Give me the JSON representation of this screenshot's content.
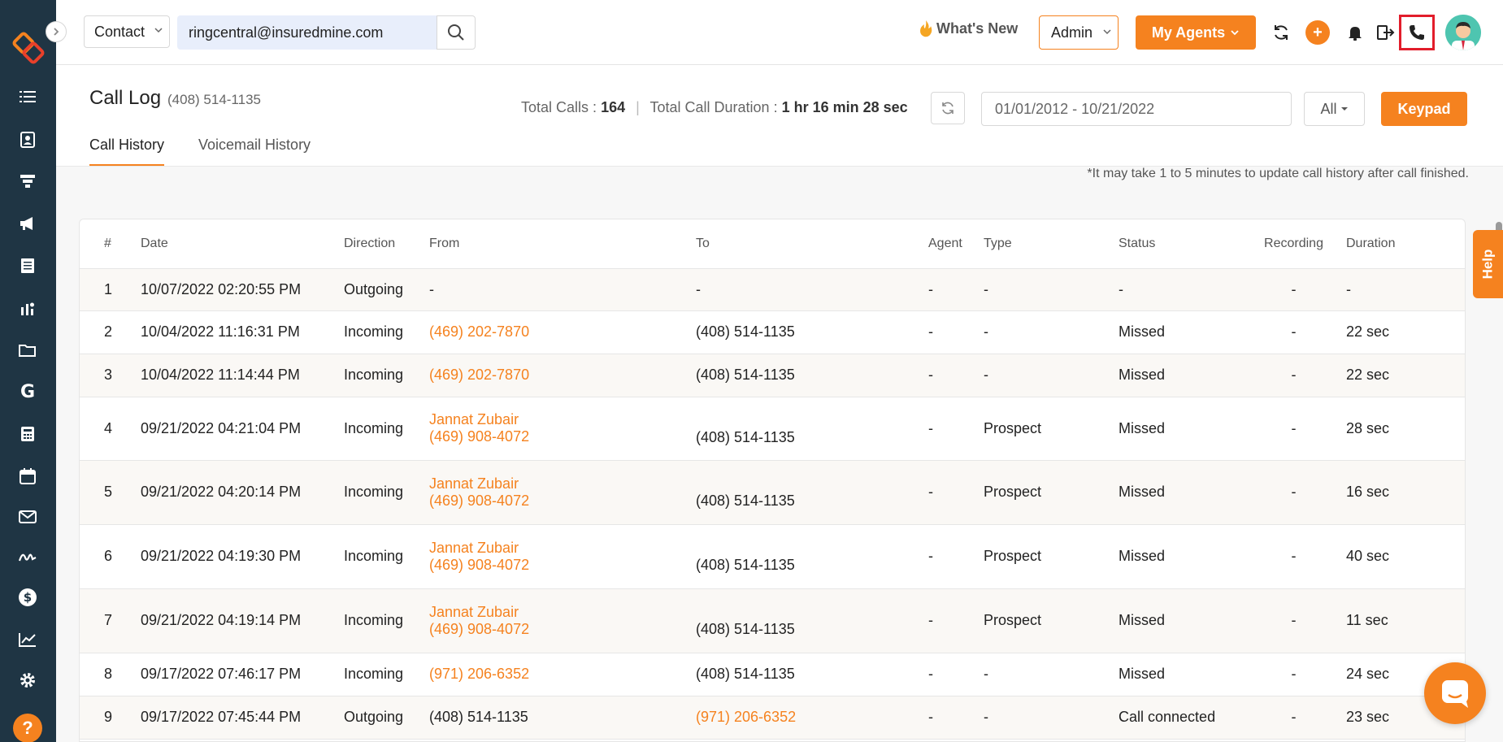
{
  "topbar": {
    "contact_select": "Contact",
    "search_value": "ringcentral@insuredmine.com",
    "whats_new": "What's New",
    "role_select": "Admin",
    "my_agents": "My Agents"
  },
  "header": {
    "title": "Call Log",
    "phone": "(408) 514-1135",
    "total_calls_label": "Total Calls :",
    "total_calls_value": "164",
    "total_duration_label": "Total Call Duration :",
    "total_duration_value": "1 hr 16 min 28 sec",
    "date_range": "01/01/2012 - 10/21/2022",
    "filter": "All",
    "keypad": "Keypad"
  },
  "tabs": [
    {
      "label": "Call History",
      "active": true
    },
    {
      "label": "Voicemail History",
      "active": false
    }
  ],
  "note": "*It may take 1 to 5 minutes to update call history after call finished.",
  "table": {
    "columns": [
      "#",
      "Date",
      "Direction",
      "From",
      "To",
      "Agent",
      "Type",
      "Status",
      "Recording",
      "Duration"
    ],
    "rows": [
      {
        "num": "1",
        "date": "10/07/2022 02:20:55 PM",
        "direction": "Outgoing",
        "from_name": "",
        "from": "-",
        "from_link": false,
        "to": "-",
        "to_link": false,
        "agent": "-",
        "type": "-",
        "status": "-",
        "recording": "-",
        "duration": "-"
      },
      {
        "num": "2",
        "date": "10/04/2022 11:16:31 PM",
        "direction": "Incoming",
        "from_name": "",
        "from": "(469) 202-7870",
        "from_link": true,
        "to": "(408) 514-1135",
        "to_link": false,
        "agent": "-",
        "type": "-",
        "status": "Missed",
        "recording": "-",
        "duration": "22 sec"
      },
      {
        "num": "3",
        "date": "10/04/2022 11:14:44 PM",
        "direction": "Incoming",
        "from_name": "",
        "from": "(469) 202-7870",
        "from_link": true,
        "to": "(408) 514-1135",
        "to_link": false,
        "agent": "-",
        "type": "-",
        "status": "Missed",
        "recording": "-",
        "duration": "22 sec"
      },
      {
        "num": "4",
        "date": "09/21/2022 04:21:04 PM",
        "direction": "Incoming",
        "from_name": "Jannat Zubair",
        "from": "(469) 908-4072",
        "from_link": true,
        "to": "(408) 514-1135",
        "to_link": false,
        "agent": "-",
        "type": "Prospect",
        "status": "Missed",
        "recording": "-",
        "duration": "28 sec"
      },
      {
        "num": "5",
        "date": "09/21/2022 04:20:14 PM",
        "direction": "Incoming",
        "from_name": "Jannat Zubair",
        "from": "(469) 908-4072",
        "from_link": true,
        "to": "(408) 514-1135",
        "to_link": false,
        "agent": "-",
        "type": "Prospect",
        "status": "Missed",
        "recording": "-",
        "duration": "16 sec"
      },
      {
        "num": "6",
        "date": "09/21/2022 04:19:30 PM",
        "direction": "Incoming",
        "from_name": "Jannat Zubair",
        "from": "(469) 908-4072",
        "from_link": true,
        "to": "(408) 514-1135",
        "to_link": false,
        "agent": "-",
        "type": "Prospect",
        "status": "Missed",
        "recording": "-",
        "duration": "40 sec"
      },
      {
        "num": "7",
        "date": "09/21/2022 04:19:14 PM",
        "direction": "Incoming",
        "from_name": "Jannat Zubair",
        "from": "(469) 908-4072",
        "from_link": true,
        "to": "(408) 514-1135",
        "to_link": false,
        "agent": "-",
        "type": "Prospect",
        "status": "Missed",
        "recording": "-",
        "duration": "11 sec"
      },
      {
        "num": "8",
        "date": "09/17/2022 07:46:17 PM",
        "direction": "Incoming",
        "from_name": "",
        "from": "(971) 206-6352",
        "from_link": true,
        "to": "(408) 514-1135",
        "to_link": false,
        "agent": "-",
        "type": "-",
        "status": "Missed",
        "recording": "-",
        "duration": "24 sec"
      },
      {
        "num": "9",
        "date": "09/17/2022 07:45:44 PM",
        "direction": "Outgoing",
        "from_name": "",
        "from": "(408) 514-1135",
        "from_link": false,
        "to": "(971) 206-6352",
        "to_link": true,
        "agent": "-",
        "type": "-",
        "status": "Call connected",
        "recording": "-",
        "duration": "23 sec"
      }
    ]
  },
  "help_tab": "Help",
  "colors": {
    "accent": "#f5821f",
    "sidebar": "#1f3544",
    "highlight": "#e21d2b"
  },
  "icons": [
    "logo-icon",
    "list-icon",
    "contacts-icon",
    "funnel-icon",
    "megaphone-icon",
    "document-icon",
    "bar-chart-icon",
    "folder-icon",
    "google-icon",
    "calculator-icon",
    "calendar-icon",
    "mail-icon",
    "signature-icon",
    "dollar-icon",
    "line-chart-icon",
    "gear-icon",
    "question-icon",
    "search-icon",
    "fire-icon",
    "sync-icon",
    "plus-icon",
    "bell-icon",
    "logout-icon",
    "phone-icon",
    "refresh-icon",
    "chat-icon"
  ]
}
